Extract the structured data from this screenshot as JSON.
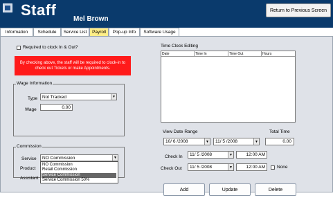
{
  "header": {
    "title": "Staff",
    "staff_name": "Mel Brown",
    "return_label": "Return to Previous Screen",
    "bg_color": "#0a3a6c"
  },
  "tabs": [
    {
      "label": "Information",
      "active": false
    },
    {
      "label": "Schedule",
      "active": false
    },
    {
      "label": "Service List",
      "active": false
    },
    {
      "label": "Payroll",
      "active": true
    },
    {
      "label": "Pop-up Info",
      "active": false
    },
    {
      "label": "Software Usage",
      "active": false
    }
  ],
  "clock": {
    "required_label": "Required to clock In & Out?",
    "required_checked": false,
    "warning": "By checking above, the staff will be required to clock-in to check out Tickets or make Appointments.",
    "warning_color": "#ff1a1a"
  },
  "wage": {
    "group_label": "Wage Information",
    "type_label": "Type",
    "type_value": "Not Tracked",
    "wage_label": "Wage",
    "wage_value": "0.00"
  },
  "commission": {
    "group_label": "Commission",
    "service_label": "Service",
    "service_value": "NO Commission",
    "product_label": "Product",
    "assistant_label": "Assistant",
    "options": [
      "NO Commission",
      "Retail Commission",
      "Service Commission",
      "Service Commission 50%"
    ],
    "selected_index": 2
  },
  "time_clock": {
    "label": "Time Clock Editing",
    "columns": [
      "Date",
      "Time In",
      "Time Out",
      "Hours"
    ]
  },
  "range": {
    "view_label": "View Date Range",
    "total_label": "Total Time",
    "from_date": "10/ 6 /2008",
    "to_date": "11/ 5 /2008",
    "total_value": "0.00",
    "check_in_label": "Check In",
    "check_in_date": "11/ 5 /2008",
    "check_in_time": "12:00 AM",
    "check_out_label": "Check Out",
    "check_out_date": "11/ 5 /2008",
    "check_out_time": "12:00 AM",
    "none_label": "None"
  },
  "actions": {
    "add": "Add",
    "update": "Update",
    "delete": "Delete"
  }
}
